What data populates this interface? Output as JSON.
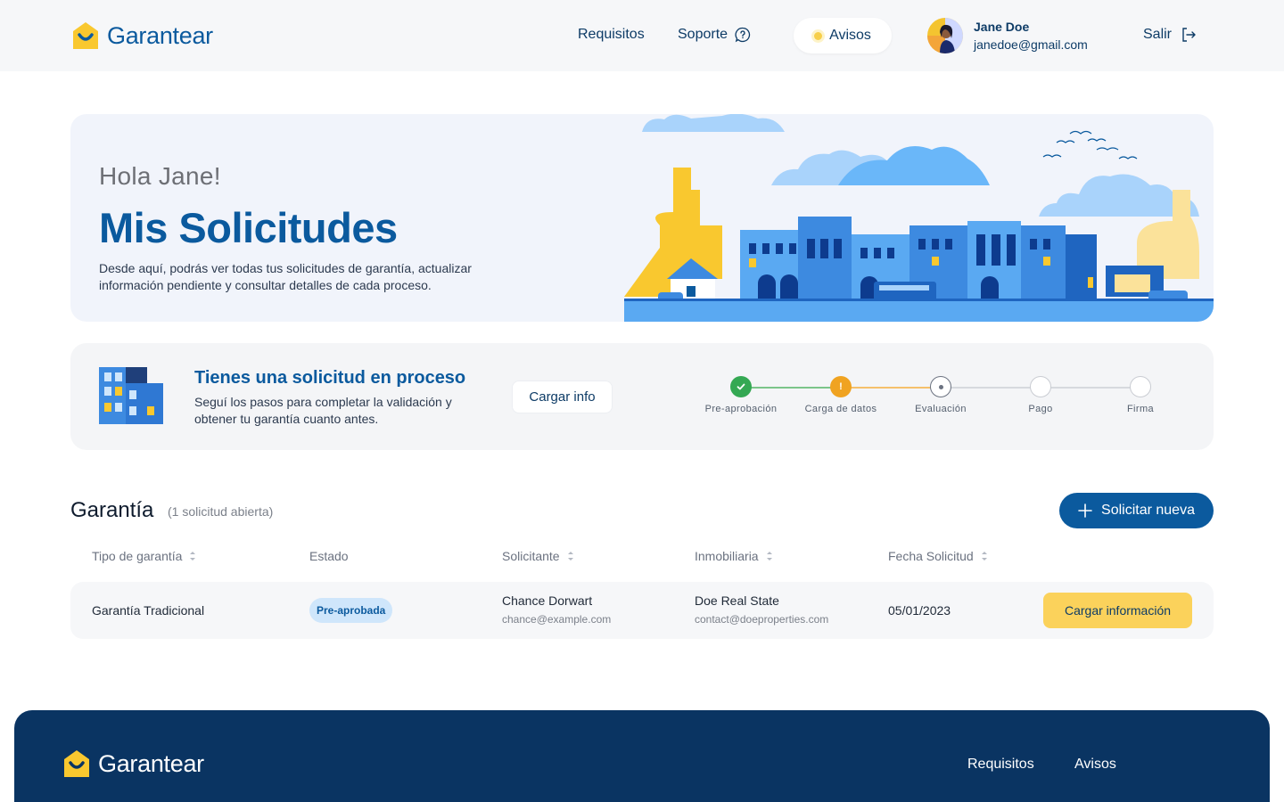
{
  "header": {
    "brand": "Garantear",
    "nav": {
      "requisitos": "Requisitos",
      "soporte": "Soporte",
      "avisos": "Avisos"
    },
    "user": {
      "name": "Jane Doe",
      "email": "janedoe@gmail.com"
    },
    "logout": "Salir"
  },
  "hero": {
    "greeting": "Hola Jane!",
    "title": "Mis Solicitudes",
    "description": "Desde aquí, podrás ver todas tus solicitudes de garantía, actualizar información pendiente y consultar detalles de cada proceso."
  },
  "process": {
    "title": "Tienes una solicitud en proceso",
    "description": "Seguí los pasos para completar la validación y obtener tu garantía cuanto antes.",
    "button": "Cargar info",
    "steps": [
      {
        "label": "Pre-aprobación",
        "status": "done"
      },
      {
        "label": "Carga de datos",
        "status": "warning"
      },
      {
        "label": "Evaluación",
        "status": "current"
      },
      {
        "label": "Pago",
        "status": "pending"
      },
      {
        "label": "Firma",
        "status": "pending"
      }
    ],
    "colors": {
      "done": "#34a853",
      "warning": "#f0a321",
      "pending": "#c9ccd2"
    }
  },
  "section": {
    "title": "Garantía",
    "count": "(1 solicitud abierta)",
    "new_button": "Solicitar nueva"
  },
  "table": {
    "headers": [
      "Tipo de garantía",
      "Estado",
      "Solicitante",
      "Inmobiliaria",
      "Fecha Solicitud"
    ],
    "rows": [
      {
        "tipo": "Garantía Tradicional",
        "estado": "Pre-aprobada",
        "solicitante": "Chance Dorwart",
        "solicitante_email": "chance@example.com",
        "inmobiliaria": "Doe Real State",
        "inmobiliaria_email": "contact@doeproperties.com",
        "fecha": "05/01/2023",
        "action": "Cargar información"
      }
    ]
  },
  "footer": {
    "brand": "Garantear",
    "links": [
      "Requisitos",
      "Avisos"
    ]
  }
}
